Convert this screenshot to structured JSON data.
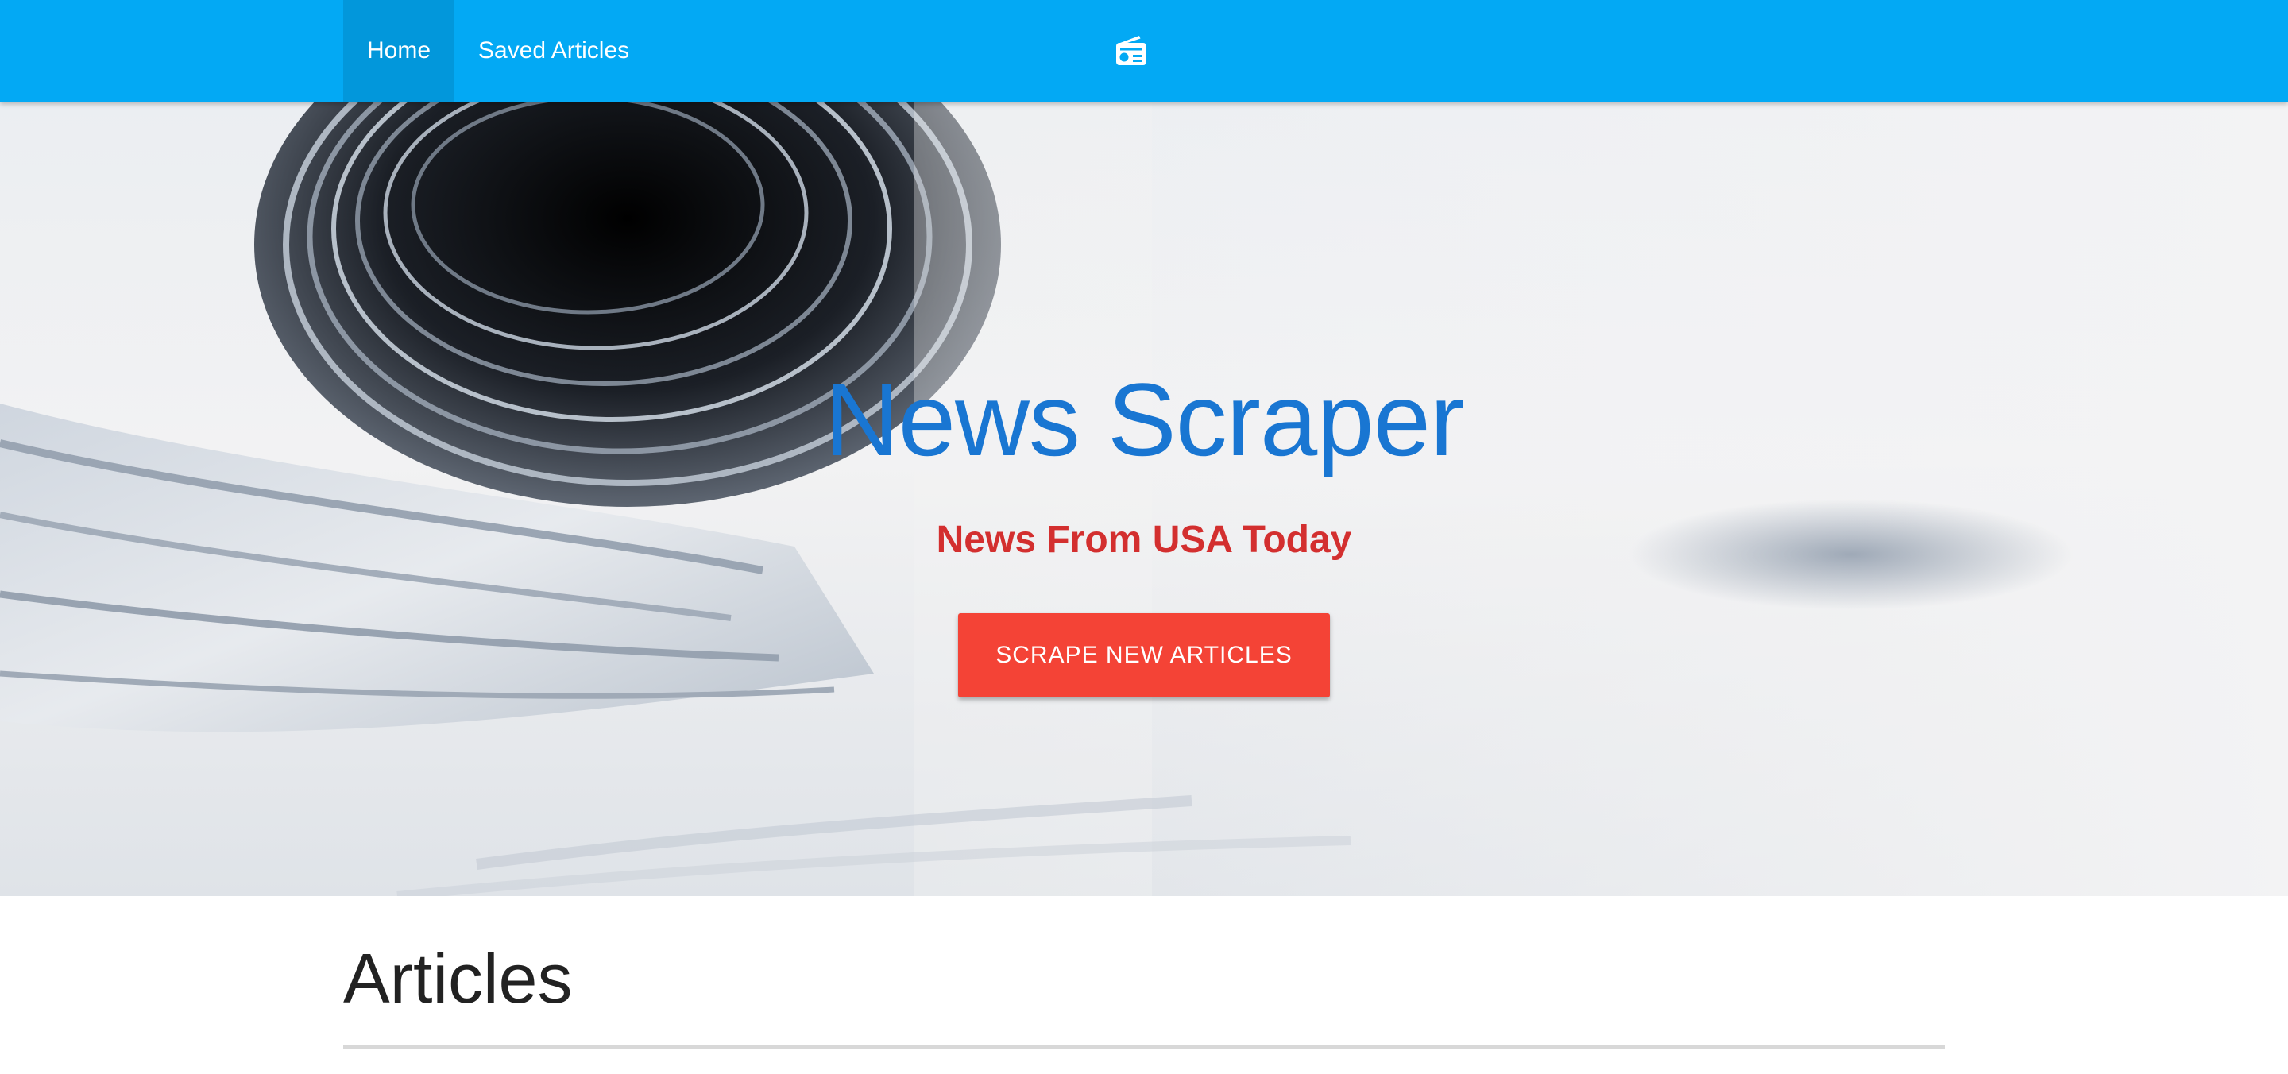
{
  "nav": {
    "items": [
      {
        "label": "Home"
      },
      {
        "label": "Saved Articles"
      }
    ],
    "logo_icon": "radio-icon"
  },
  "hero": {
    "title": "News Scraper",
    "subtitle": "News From USA Today",
    "button_label": "SCRAPE NEW ARTICLES"
  },
  "articles": {
    "heading": "Articles"
  },
  "colors": {
    "navbar": "#03a9f4",
    "title": "#1976d2",
    "subtitle": "#d32f2f",
    "button": "#f44336"
  }
}
